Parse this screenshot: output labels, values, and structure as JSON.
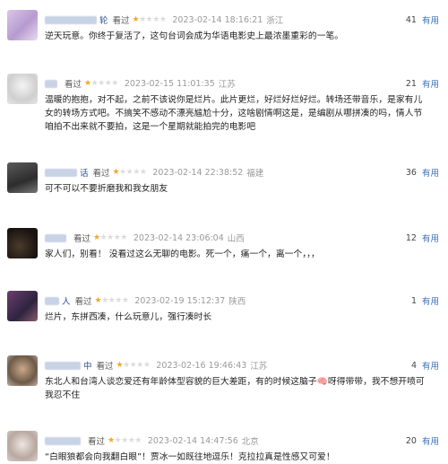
{
  "colors": {
    "star": "#f5a623",
    "star_empty": "#dcdcdc",
    "link": "#3a6fb8",
    "time": "#9a9a9a"
  },
  "reviews": [
    {
      "user_suffix": "轮",
      "seen": "看过",
      "rating": 1,
      "time": "2023-02-14 18:16:21",
      "location": "浙江",
      "votes": "41",
      "useful": "有用",
      "content": "逆天玩意。你终于复活了，这句台词会成为华语电影史上最浓墨重彩的一笔。"
    },
    {
      "user_suffix": "",
      "seen": "看过",
      "rating": 1,
      "time": "2023-02-15 11:01:35",
      "location": "江苏",
      "votes": "21",
      "useful": "有用",
      "content": "温暖的抱抱，对不起，之前不该说你是烂片。此片更烂，好烂好烂好烂。转场还带音乐，是家有儿女的转场方式吧。不搞笑不感动不漂亮尴尬十分，这啥剧情啊这是，是编剧从哪拼凑的吗，情人节咱拍不出来就不要拍，这是一个星期就能拍完的电影吧"
    },
    {
      "user_suffix": "话",
      "seen": "看过",
      "rating": 1,
      "time": "2023-02-14 22:38:52",
      "location": "福建",
      "votes": "36",
      "useful": "有用",
      "content": "可不可以不要折磨我和我女朋友"
    },
    {
      "user_suffix": "",
      "seen": "看过",
      "rating": 1,
      "time": "2023-02-14 23:06:04",
      "location": "山西",
      "votes": "12",
      "useful": "有用",
      "content": "家人们，别看！ 没看过这么无聊的电影。死一个，痛一个，离一个，，，"
    },
    {
      "user_suffix": "人",
      "seen": "看过",
      "rating": 1,
      "time": "2023-02-19 15:12:37",
      "location": "陕西",
      "votes": "1",
      "useful": "有用",
      "content": "烂片，东拼西凑，什么玩意儿，强行凑时长"
    },
    {
      "user_suffix": "中",
      "seen": "看过",
      "rating": 1,
      "time": "2023-02-16 19:46:43",
      "location": "江苏",
      "votes": "4",
      "useful": "有用",
      "content": "东北人和台湾人谈恋爱还有年龄体型容貌的巨大差距，有的时候这脑子🧠呀得带带，我不想开喷可我忍不住"
    },
    {
      "user_suffix": "",
      "seen": "看过",
      "rating": 1,
      "time": "2023-02-14 14:47:56",
      "location": "北京",
      "votes": "20",
      "useful": "有用",
      "content": "“白眼狼都会向我翻白眼”！贾冰一如既往地逗乐！克拉拉真是性感又可爱！"
    }
  ]
}
